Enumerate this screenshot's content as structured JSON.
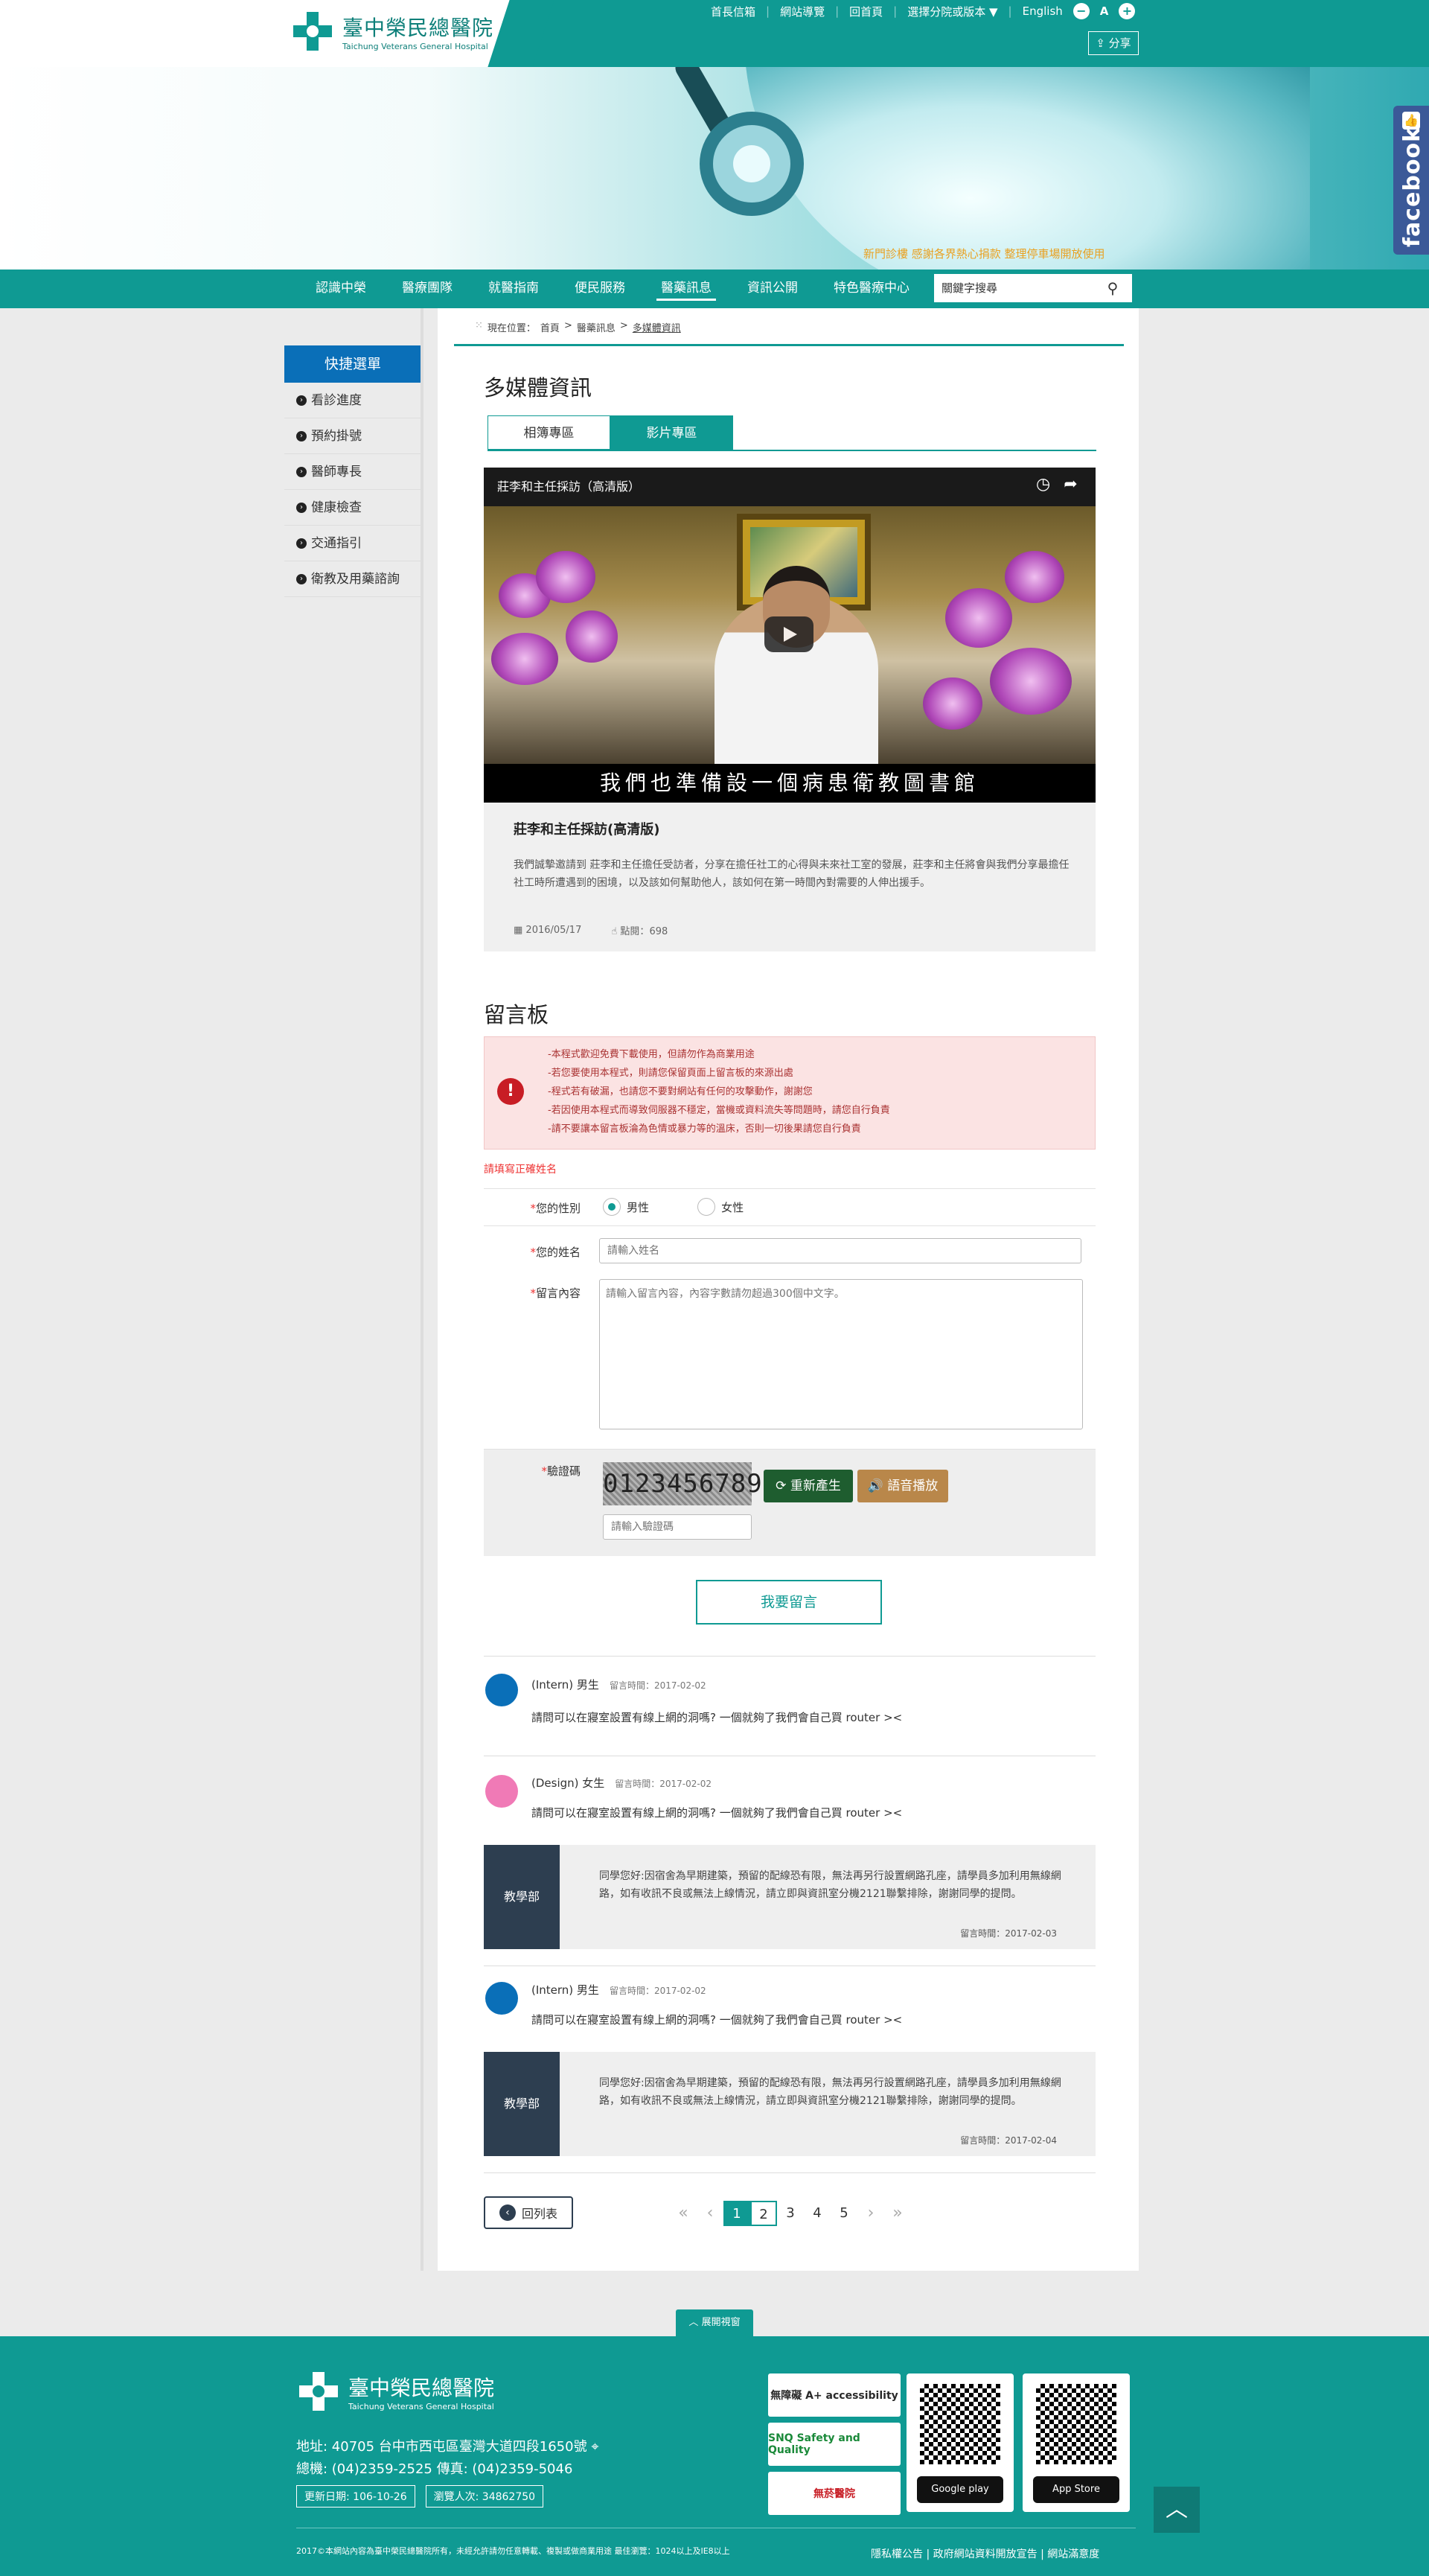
{
  "header": {
    "logo_zh": "臺中榮民總醫院",
    "logo_en": "Taichung Veterans General Hospital",
    "top_links": [
      "首長信箱",
      "網站導覽",
      "回首頁",
      "選擇分院或版本 ▼",
      "English"
    ],
    "font_small": "−",
    "font_mid": "A",
    "font_large": "+",
    "share_label": "分享",
    "marquee": "新門診樓 感謝各界熱心捐款 整理停車場開放使用"
  },
  "nav": {
    "items": [
      "認識中榮",
      "醫療團隊",
      "就醫指南",
      "便民服務",
      "醫藥訊息",
      "資訊公開",
      "特色醫療中心"
    ],
    "active_index": 4,
    "search_placeholder": "關鍵字搜尋"
  },
  "facebook_label": "facebook",
  "sidebar": {
    "title": "快捷選單",
    "items": [
      "看診進度",
      "預約掛號",
      "醫師專長",
      "健康檢查",
      "交通指引",
      "衛教及用藥諮詢"
    ]
  },
  "breadcrumb": {
    "prefix": "現在位置：",
    "items": [
      "首頁",
      "醫藥訊息"
    ],
    "current": "多媒體資訊"
  },
  "page_title": "多媒體資訊",
  "tabs": [
    {
      "label": "相簿專區",
      "active": false
    },
    {
      "label": "影片專區",
      "active": true
    }
  ],
  "video": {
    "overlay_title": "莊李和主任採訪（高清版）",
    "caption": "我們也準備設一個病患衛教圖書館",
    "title": "莊李和主任採訪(高清版)",
    "description": "我們誠摯邀請到 莊李和主任擔任受訪者，分享在擔任社工的心得與未來社工室的發展，莊李和主任將會與我們分享最擔任社工時所遭遇到的困境，以及該如何幫助他人，該如何在第一時間內對需要的人伸出援手。",
    "date": "2016/05/17",
    "views_label": "點閱：",
    "views": "698"
  },
  "guestbook": {
    "title": "留言板",
    "notices": [
      "-本程式歡迎免費下載使用，但請勿作為商業用途",
      "-若您要使用本程式，則請您保留頁面上留言板的來源出處",
      "-程式若有破漏，也請您不要對網站有任何的攻擊動作，謝謝您",
      "-若因使用本程式而導致伺服器不穩定，當機或資料流失等問題時，請您自行負責",
      "-請不要讓本留言板淪為色情或暴力等的溫床，否則一切後果請您自行負責"
    ],
    "error": "請填寫正確姓名",
    "gender_label": "您的性別",
    "gender_male": "男性",
    "gender_female": "女性",
    "name_label": "您的姓名",
    "name_placeholder": "請輸入姓名",
    "content_label": "留言內容",
    "content_placeholder": "請輸入留言內容，內容字數請勿超過300個中文字。",
    "captcha_label": "驗證碼",
    "captcha_text": "0123456789",
    "refresh_label": "重新產生",
    "audio_label": "語音播放",
    "captcha_placeholder": "請輸入驗證碼",
    "submit_label": "我要留言"
  },
  "comments": [
    {
      "author": "(Intern) 男生",
      "time_label": "留言時間：2017-02-02",
      "text": "請問可以在寢室設置有線上網的洞嗎? 一個就夠了我們會自己買 router ><",
      "avatar_color": "#0a6fb8",
      "reply": null
    },
    {
      "author": "(Design) 女生",
      "time_label": "留言時間：2017-02-02",
      "text": "請問可以在寢室設置有線上網的洞嗎? 一個就夠了我們會自己買 router ><",
      "avatar_color": "#f07ab6",
      "reply": {
        "dept": "教學部",
        "text": "同學您好:因宿舍為早期建築，預留的配線恐有限，無法再另行設置網路孔座，請學員多加利用無線網路，如有收訊不良或無法上線情況，請立即與資訊室分機2121聯繫排除，謝謝同學的提問。",
        "time": "留言時間：2017-02-03"
      }
    },
    {
      "author": "(Intern) 男生",
      "time_label": "留言時間：2017-02-02",
      "text": "請問可以在寢室設置有線上網的洞嗎? 一個就夠了我們會自己買 router ><",
      "avatar_color": "#0a6fb8",
      "reply": {
        "dept": "教學部",
        "text": "同學您好:因宿舍為早期建築，預留的配線恐有限，無法再另行設置網路孔座，請學員多加利用無線網路，如有收訊不良或無法上線情況，請立即與資訊室分機2121聯繫排除，謝謝同學的提問。",
        "time": "留言時間：2017-02-04"
      }
    }
  ],
  "pagination": {
    "back_label": "回列表",
    "pages": [
      "1",
      "2",
      "3",
      "4",
      "5"
    ],
    "current": "1"
  },
  "footer": {
    "expand_label": "展開視窗",
    "logo_zh": "臺中榮民總醫院",
    "logo_en": "Taichung Veterans General Hospital",
    "address": "地址: 40705 台中市西屯區臺灣大道四段1650號",
    "phone": "總機: (04)2359-2525   傳真: (04)2359-5046",
    "updated": "更新日期: 106-10-26",
    "visitors": "瀏覽人次: 34862750",
    "copyright": "2017©本網站內容為臺中榮民總醫院所有，未經允許請勿任意轉載、複製或做商業用途   最佳瀏覽：1024以上及IE8以上",
    "links": "隱私權公告 | 政府網站資料開放宣告 | 網站滿意度",
    "badges": [
      "無障礙 A+ accessibility",
      "SNQ Safety and Quality",
      "無菸醫院"
    ],
    "store_android": "Google play",
    "store_ios": "App Store"
  },
  "colors": {
    "teal": "#0f9a93",
    "blue": "#0a6fb8",
    "navy": "#2d3e50",
    "warn": "#c81d25"
  }
}
